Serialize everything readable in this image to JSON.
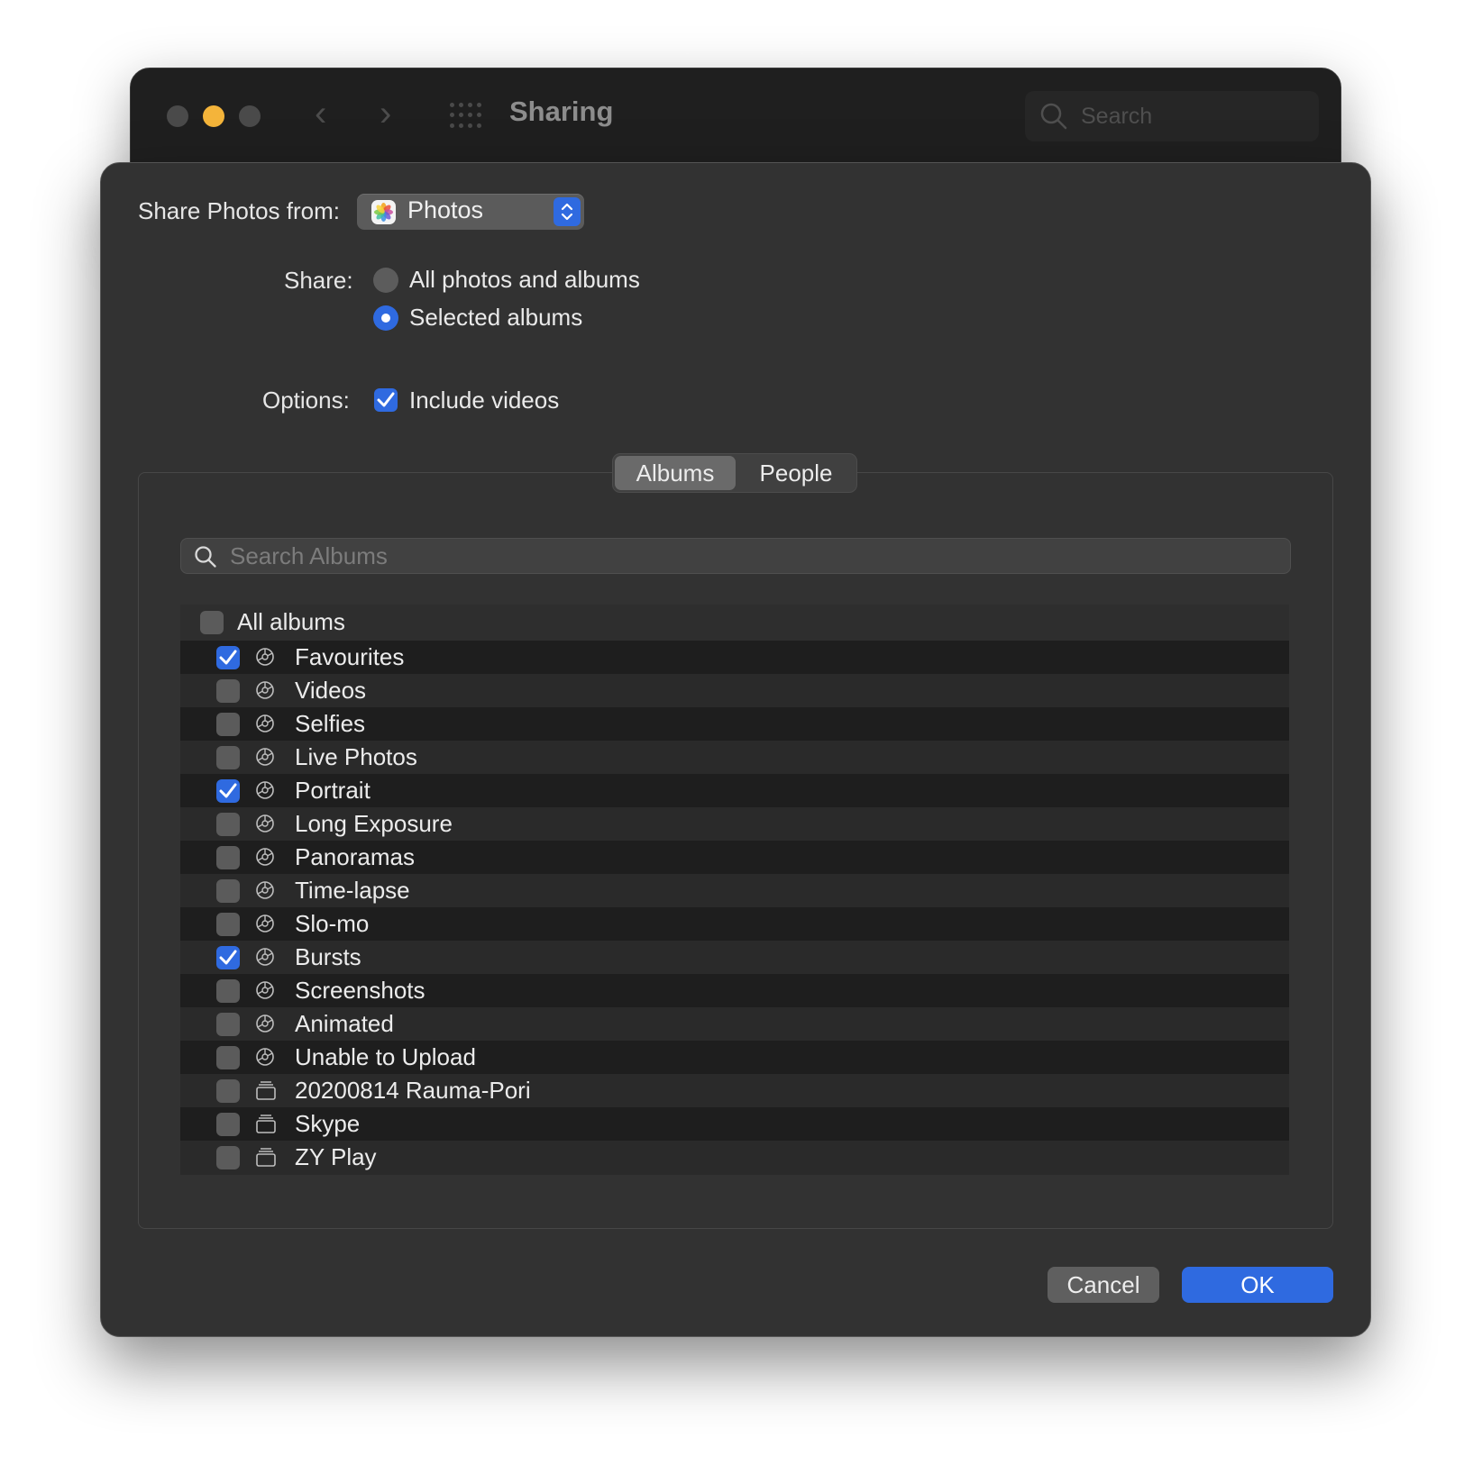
{
  "window": {
    "title": "Sharing",
    "search_placeholder": "Search"
  },
  "sheet": {
    "share_from_label": "Share Photos from:",
    "source_app": "Photos",
    "share_label": "Share:",
    "share_options": [
      {
        "label": "All photos and albums",
        "selected": false
      },
      {
        "label": "Selected albums",
        "selected": true
      }
    ],
    "options_label": "Options:",
    "include_videos": {
      "label": "Include videos",
      "checked": true
    },
    "tabs": [
      {
        "label": "Albums",
        "active": true
      },
      {
        "label": "People",
        "active": false
      }
    ],
    "album_search_placeholder": "Search Albums",
    "all_albums": {
      "label": "All albums",
      "checked": false
    },
    "albums": [
      {
        "label": "Favourites",
        "checked": true,
        "icon": "smart-album-icon"
      },
      {
        "label": "Videos",
        "checked": false,
        "icon": "smart-album-icon"
      },
      {
        "label": "Selfies",
        "checked": false,
        "icon": "smart-album-icon"
      },
      {
        "label": "Live Photos",
        "checked": false,
        "icon": "smart-album-icon"
      },
      {
        "label": "Portrait",
        "checked": true,
        "icon": "smart-album-icon"
      },
      {
        "label": "Long Exposure",
        "checked": false,
        "icon": "smart-album-icon"
      },
      {
        "label": "Panoramas",
        "checked": false,
        "icon": "smart-album-icon"
      },
      {
        "label": "Time-lapse",
        "checked": false,
        "icon": "smart-album-icon"
      },
      {
        "label": "Slo-mo",
        "checked": false,
        "icon": "smart-album-icon"
      },
      {
        "label": "Bursts",
        "checked": true,
        "icon": "smart-album-icon"
      },
      {
        "label": "Screenshots",
        "checked": false,
        "icon": "smart-album-icon"
      },
      {
        "label": "Animated",
        "checked": false,
        "icon": "smart-album-icon"
      },
      {
        "label": "Unable to Upload",
        "checked": false,
        "icon": "smart-album-icon"
      },
      {
        "label": "20200814 Rauma-Pori",
        "checked": false,
        "icon": "album-stack-icon"
      },
      {
        "label": "Skype",
        "checked": false,
        "icon": "album-stack-icon"
      },
      {
        "label": "ZY Play",
        "checked": false,
        "icon": "album-stack-icon"
      }
    ],
    "cancel_label": "Cancel",
    "ok_label": "OK"
  },
  "colors": {
    "accent": "#2f6ae0",
    "minimize": "#f4b43a",
    "sheet_bg": "#323232"
  }
}
